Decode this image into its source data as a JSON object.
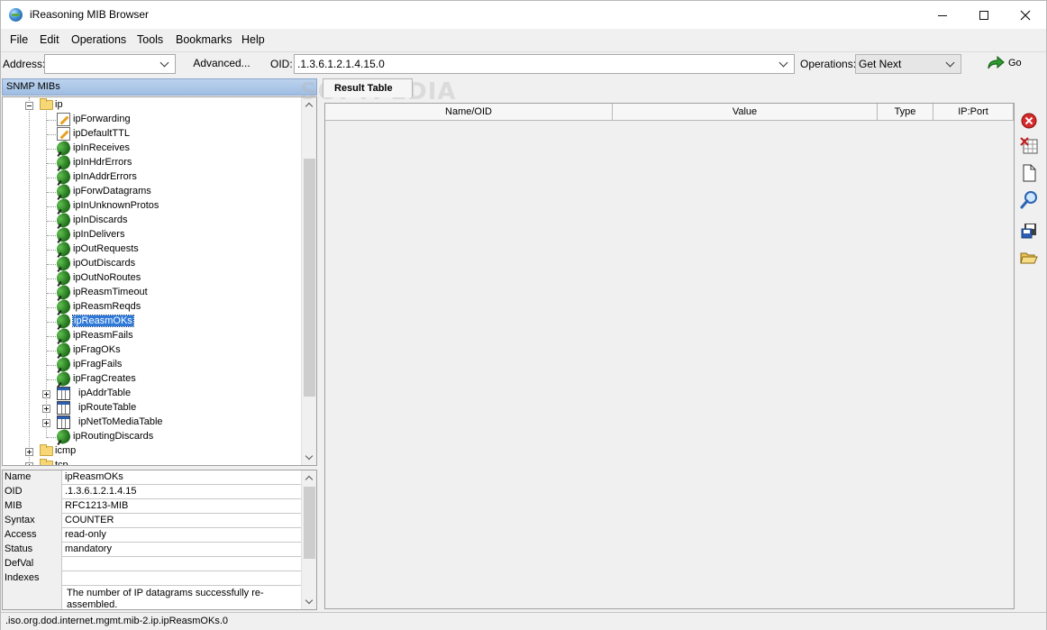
{
  "window": {
    "title": "iReasoning MIB Browser"
  },
  "menu": [
    "File",
    "Edit",
    "Operations",
    "Tools",
    "Bookmarks",
    "Help"
  ],
  "toolbar": {
    "address_label": "Address:",
    "address_value": "",
    "advanced_label": "Advanced...",
    "oid_label": "OID:",
    "oid_value": ".1.3.6.1.2.1.4.15.0",
    "operations_label": "Operations:",
    "operations_value": "Get Next",
    "go_label": "Go"
  },
  "mib_panel": {
    "title": "SNMP MIBs",
    "tree": [
      {
        "label": "ip",
        "icon": "folder-icon",
        "expander": "minus"
      },
      {
        "label": "ipForwarding",
        "icon": "read-write-icon"
      },
      {
        "label": "ipDefaultTTL",
        "icon": "read-write-icon"
      },
      {
        "label": "ipInReceives",
        "icon": "leaf-icon"
      },
      {
        "label": "ipInHdrErrors",
        "icon": "leaf-icon"
      },
      {
        "label": "ipInAddrErrors",
        "icon": "leaf-icon"
      },
      {
        "label": "ipForwDatagrams",
        "icon": "leaf-icon"
      },
      {
        "label": "ipInUnknownProtos",
        "icon": "leaf-icon"
      },
      {
        "label": "ipInDiscards",
        "icon": "leaf-icon"
      },
      {
        "label": "ipInDelivers",
        "icon": "leaf-icon"
      },
      {
        "label": "ipOutRequests",
        "icon": "leaf-icon"
      },
      {
        "label": "ipOutDiscards",
        "icon": "leaf-icon"
      },
      {
        "label": "ipOutNoRoutes",
        "icon": "leaf-icon"
      },
      {
        "label": "ipReasmTimeout",
        "icon": "leaf-icon"
      },
      {
        "label": "ipReasmReqds",
        "icon": "leaf-icon"
      },
      {
        "label": "ipReasmOKs",
        "icon": "leaf-icon",
        "selected": true
      },
      {
        "label": "ipReasmFails",
        "icon": "leaf-icon"
      },
      {
        "label": "ipFragOKs",
        "icon": "leaf-icon"
      },
      {
        "label": "ipFragFails",
        "icon": "leaf-icon"
      },
      {
        "label": "ipFragCreates",
        "icon": "leaf-icon"
      },
      {
        "label": "ipAddrTable",
        "icon": "table-icon",
        "expander": "plus"
      },
      {
        "label": "ipRouteTable",
        "icon": "table-icon",
        "expander": "plus"
      },
      {
        "label": "ipNetToMediaTable",
        "icon": "table-icon",
        "expander": "plus"
      },
      {
        "label": "ipRoutingDiscards",
        "icon": "leaf-icon"
      },
      {
        "label": "icmp",
        "icon": "folder-icon",
        "expander": "plus"
      },
      {
        "label": "tcp",
        "icon": "folder-icon",
        "expander": "plus"
      }
    ]
  },
  "properties": [
    {
      "key": "Name",
      "value": "ipReasmOKs"
    },
    {
      "key": "OID",
      "value": ".1.3.6.1.2.1.4.15"
    },
    {
      "key": "MIB",
      "value": "RFC1213-MIB"
    },
    {
      "key": "Syntax",
      "value": "COUNTER"
    },
    {
      "key": "Access",
      "value": "read-only"
    },
    {
      "key": "Status",
      "value": "mandatory"
    },
    {
      "key": "DefVal",
      "value": ""
    },
    {
      "key": "Indexes",
      "value": ""
    },
    {
      "key": "",
      "value": "The number of IP datagrams successfully re-assembled."
    }
  ],
  "result": {
    "tab_label": "Result Table",
    "columns": [
      "Name/OID",
      "Value",
      "Type",
      "IP:Port"
    ]
  },
  "side_tools": [
    "stop-icon",
    "delete-icon",
    "document-icon",
    "magnifier-icon",
    "save-icon",
    "open-folder-icon"
  ],
  "watermark": "SOFTPEDIA",
  "status": {
    "text": ".iso.org.dod.internet.mgmt.mib-2.ip.ipReasmOKs.0"
  }
}
